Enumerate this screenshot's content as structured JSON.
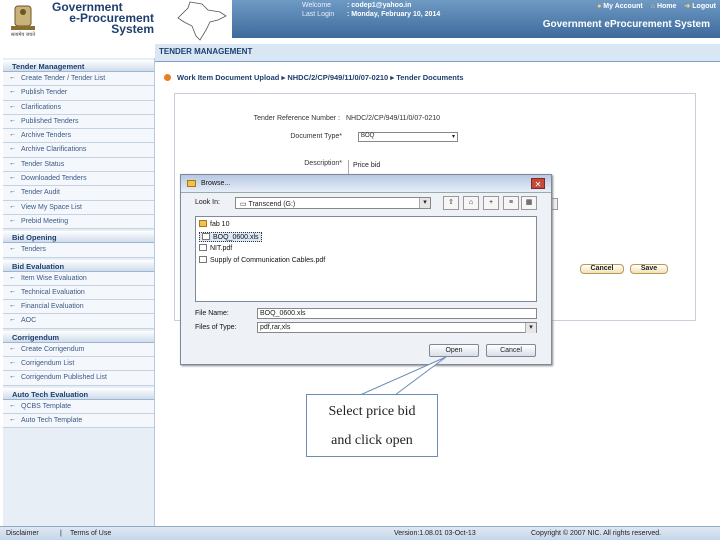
{
  "header": {
    "brand_line1": "Government",
    "brand_line2": "e-Procurement",
    "brand_line3": "System",
    "welcome_label": "Welcome",
    "welcome_value": ": codep1@yahoo.in",
    "lastlogin_label": "Last Login",
    "lastlogin_value": ": Monday, February 10, 2014",
    "my_account": "My Account",
    "home": "Home",
    "logout": "Logout",
    "system_name": "Government eProcurement System"
  },
  "section_title": "TENDER MANAGEMENT",
  "sidebar": {
    "sections": [
      {
        "title": "Tender Management",
        "items": [
          "Create Tender / Tender List",
          "Publish Tender",
          "Clarifications",
          "Published Tenders",
          "Archive Tenders",
          "Archive Clarifications",
          "Tender Status",
          "Downloaded Tenders",
          "Tender Audit",
          "View My Space List",
          "Prebid Meeting"
        ]
      },
      {
        "title": "Bid Opening",
        "items": [
          "Tenders"
        ]
      },
      {
        "title": "Bid Evaluation",
        "items": [
          "Item Wise Evaluation",
          "Technical Evaluation",
          "Financial Evaluation",
          "AOC"
        ]
      },
      {
        "title": "Corrigendum",
        "items": [
          "Create Corrigendum",
          "Corrigendum List",
          "Corrigendum Published List"
        ]
      },
      {
        "title": "Auto Tech Evaluation",
        "items": [
          "QCBS Template",
          "Auto Tech Template"
        ]
      }
    ]
  },
  "breadcrumb": {
    "page": "Work Item Document Upload",
    "tender_ref": "NHDC/2/CP/949/11/0/07-0210",
    "doc": "Tender Documents"
  },
  "form": {
    "ref_label": "Tender Reference Number :",
    "ref_value": "NHDC/2/CP/949/11/0/07-0210",
    "doctype_label": "Document Type*",
    "doctype_value": "BOQ",
    "desc_label": "Description*",
    "desc_value": "Price bid",
    "cancel": "Cancel",
    "save": "Save"
  },
  "dialog": {
    "title": "Browse...",
    "lookin_label": "Look In:",
    "lookin_value": "Transcend (G:)",
    "files": [
      "fab 10",
      "BOQ_0600.xls",
      "NIT.pdf",
      "Supply of Communication Cables.pdf"
    ],
    "filename_label": "File Name:",
    "filename_value": "BOQ_0600.xls",
    "filetype_label": "Files of Type:",
    "filetype_value": "pdf,rar,xls",
    "open": "Open",
    "cancel": "Cancel"
  },
  "callout": {
    "line1": "Select price bid",
    "line2": "and click open"
  },
  "footer": {
    "disclaimer": "Disclaimer",
    "terms": "Terms of Use",
    "version": "Version:1.08.01 03-Oct-13",
    "copyright": "Copyright © 2007 NIC. All rights reserved."
  }
}
